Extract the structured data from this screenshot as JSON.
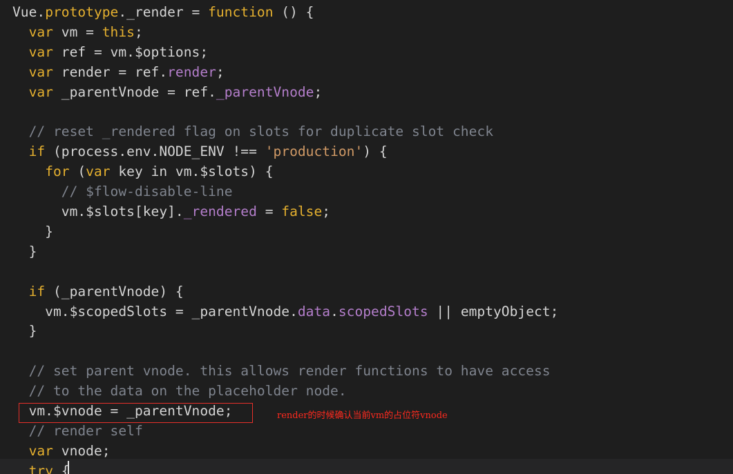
{
  "code_editor": {
    "theme_colors": {
      "background": "#1e1e1e",
      "plain": "#d4d4d4",
      "keyword": "#e5b02f",
      "member": "#b47ecb",
      "string": "#d19a66",
      "comment": "#7f848e",
      "annotation": "#ff2a1e"
    },
    "lines": [
      [
        {
          "k": "plain",
          "t": "Vue."
        },
        {
          "k": "keyword",
          "t": "prototype"
        },
        {
          "k": "plain",
          "t": "._render = "
        },
        {
          "k": "keyword",
          "t": "function"
        },
        {
          "k": "plain",
          "t": " () {"
        }
      ],
      [
        {
          "k": "plain",
          "t": "  "
        },
        {
          "k": "keyword",
          "t": "var"
        },
        {
          "k": "plain",
          "t": " vm = "
        },
        {
          "k": "keyword",
          "t": "this"
        },
        {
          "k": "plain",
          "t": ";"
        }
      ],
      [
        {
          "k": "plain",
          "t": "  "
        },
        {
          "k": "keyword",
          "t": "var"
        },
        {
          "k": "plain",
          "t": " ref = vm.$options;"
        }
      ],
      [
        {
          "k": "plain",
          "t": "  "
        },
        {
          "k": "keyword",
          "t": "var"
        },
        {
          "k": "plain",
          "t": " render = ref."
        },
        {
          "k": "member",
          "t": "render"
        },
        {
          "k": "plain",
          "t": ";"
        }
      ],
      [
        {
          "k": "plain",
          "t": "  "
        },
        {
          "k": "keyword",
          "t": "var"
        },
        {
          "k": "plain",
          "t": " _parentVnode = ref."
        },
        {
          "k": "member",
          "t": "_parentVnode"
        },
        {
          "k": "plain",
          "t": ";"
        }
      ],
      [],
      [
        {
          "k": "plain",
          "t": "  "
        },
        {
          "k": "comment",
          "t": "// reset _rendered flag on slots for duplicate slot check"
        }
      ],
      [
        {
          "k": "plain",
          "t": "  "
        },
        {
          "k": "keyword",
          "t": "if"
        },
        {
          "k": "plain",
          "t": " (process.env.NODE_ENV !== "
        },
        {
          "k": "string",
          "t": "'production'"
        },
        {
          "k": "plain",
          "t": ") {"
        }
      ],
      [
        {
          "k": "plain",
          "t": "    "
        },
        {
          "k": "keyword",
          "t": "for"
        },
        {
          "k": "plain",
          "t": " ("
        },
        {
          "k": "keyword",
          "t": "var"
        },
        {
          "k": "plain",
          "t": " key in vm.$slots) {"
        }
      ],
      [
        {
          "k": "plain",
          "t": "      "
        },
        {
          "k": "comment",
          "t": "// $flow-disable-line"
        }
      ],
      [
        {
          "k": "plain",
          "t": "      vm.$slots[key]."
        },
        {
          "k": "member",
          "t": "_rendered"
        },
        {
          "k": "plain",
          "t": " = "
        },
        {
          "k": "bool",
          "t": "false"
        },
        {
          "k": "plain",
          "t": ";"
        }
      ],
      [
        {
          "k": "plain",
          "t": "    }"
        }
      ],
      [
        {
          "k": "plain",
          "t": "  }"
        }
      ],
      [],
      [
        {
          "k": "plain",
          "t": "  "
        },
        {
          "k": "keyword",
          "t": "if"
        },
        {
          "k": "plain",
          "t": " (_parentVnode) {"
        }
      ],
      [
        {
          "k": "plain",
          "t": "    vm.$scopedSlots = _parentVnode."
        },
        {
          "k": "member",
          "t": "data"
        },
        {
          "k": "plain",
          "t": "."
        },
        {
          "k": "member",
          "t": "scopedSlots"
        },
        {
          "k": "plain",
          "t": " || emptyObject;"
        }
      ],
      [
        {
          "k": "plain",
          "t": "  }"
        }
      ],
      [],
      [
        {
          "k": "plain",
          "t": "  "
        },
        {
          "k": "comment",
          "t": "// set parent vnode. this allows render functions to have access"
        }
      ],
      [
        {
          "k": "plain",
          "t": "  "
        },
        {
          "k": "comment",
          "t": "// to the data on the placeholder node."
        }
      ],
      [
        {
          "k": "plain",
          "t": "  vm.$vnode = _parentVnode;"
        }
      ],
      [
        {
          "k": "plain",
          "t": "  "
        },
        {
          "k": "comment",
          "t": "// render self"
        }
      ],
      [
        {
          "k": "plain",
          "t": "  "
        },
        {
          "k": "keyword",
          "t": "var"
        },
        {
          "k": "plain",
          "t": " vnode;"
        }
      ],
      [
        {
          "k": "plain",
          "t": "  "
        },
        {
          "k": "keyword",
          "t": "try"
        },
        {
          "k": "plain",
          "t": " {"
        }
      ]
    ],
    "annotation": {
      "text": "render的时候确认当前vm的占位符vnode"
    }
  }
}
